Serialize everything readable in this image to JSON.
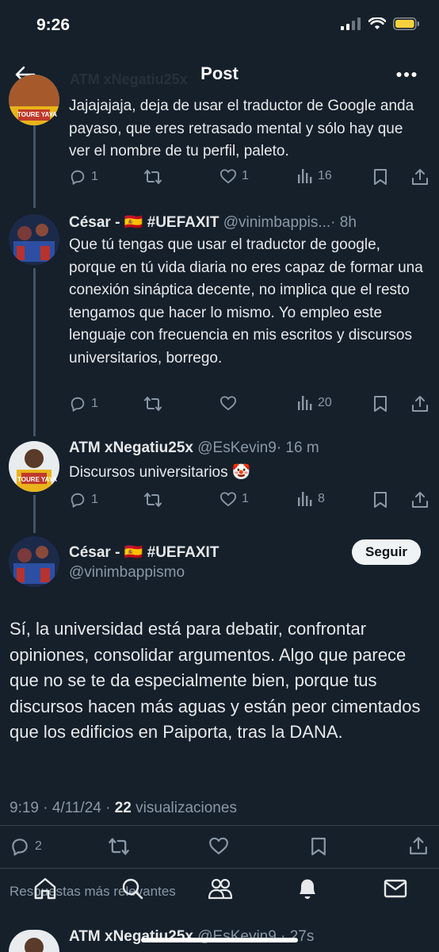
{
  "status": {
    "time": "9:26"
  },
  "header": {
    "title": "Post",
    "ghost": "ATM xNegatiu25x"
  },
  "tweets": [
    {
      "body": "Jajajajaja, deja de usar el traductor de Google anda payaso, que eres retrasado mental y sólo hay que ver el nombre de tu perfil, paleto.",
      "avatar_text": "TOURE YAYA",
      "replies": "1",
      "reposts": "",
      "likes": "1",
      "views": "16"
    },
    {
      "name": "César - 🇪🇸 #UEFAXIT",
      "handle": "@vinimbappis...",
      "time": "· 8h",
      "body": "Que tú tengas que usar el traductor de google, porque en tú vida diaria no eres capaz de formar una conexión sináptica decente, no implica que el resto tengamos que hacer lo mismo. Yo empleo este lenguaje con frecuencia en mis escritos y discursos universitarios, borrego.",
      "replies": "1",
      "reposts": "",
      "likes": "",
      "views": "20"
    },
    {
      "name": "ATM xNegatiu25x",
      "handle": "@EsKevin9",
      "time": "· 16 m",
      "body": "Discursos universitarios 🤡",
      "avatar_text": "TOURE YAYA",
      "replies": "1",
      "reposts": "",
      "likes": "1",
      "views": "8"
    }
  ],
  "main_tweet": {
    "name": "César - 🇪🇸 #UEFAXIT",
    "handle": "@vinimbappismo",
    "follow_label": "Seguir",
    "body": "Sí, la universidad está para debatir, confrontar opiniones, consolidar argumentos. Algo que parece que no se te da especialmente bien, porque tus discursos hacen más aguas y están peor cimentados que los edificios en Paiporta, tras la DANA.",
    "timestamp": "9:19 · 4/11/24 · ",
    "views_count": "22",
    "views_label": " visualizaciones",
    "replies": "2"
  },
  "footer": {
    "reply_hint": "Respuestas más relevantes",
    "next_name": "ATM xNegatiu25x",
    "next_handle": "@EsKevin9 · 27s"
  },
  "colors": {
    "background": "#15202b",
    "secondary": "#8b98a5",
    "divider": "#38444d"
  }
}
